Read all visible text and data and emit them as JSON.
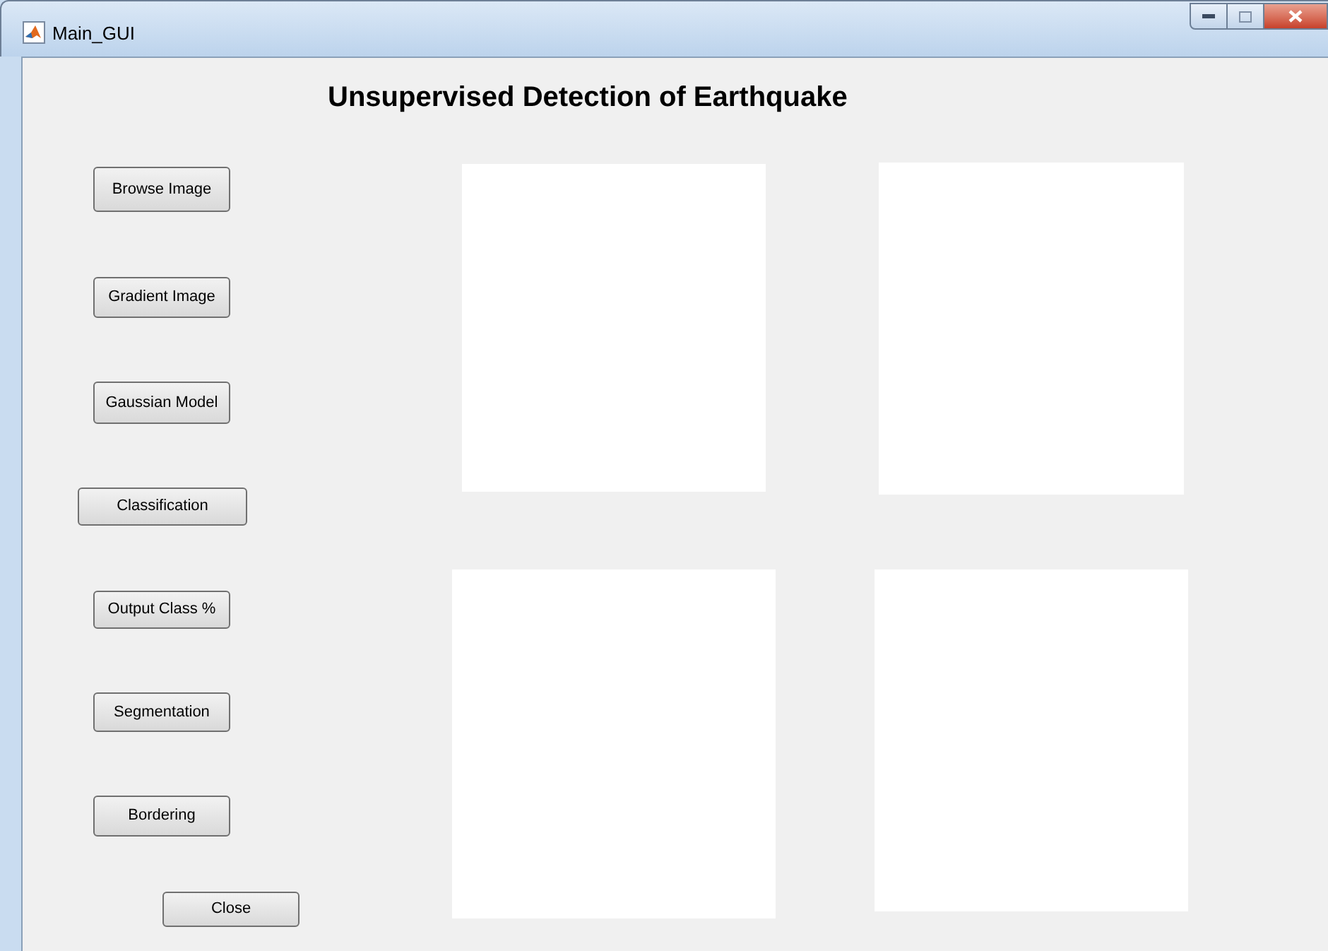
{
  "window": {
    "title": "Main_GUI"
  },
  "heading": "Unsupervised Detection of Earthquake",
  "buttons": [
    "Browse Image",
    "Gradient Image",
    "Gaussian Model",
    "Classification",
    "Output Class %",
    "Segmentation",
    "Bordering",
    "Close"
  ]
}
